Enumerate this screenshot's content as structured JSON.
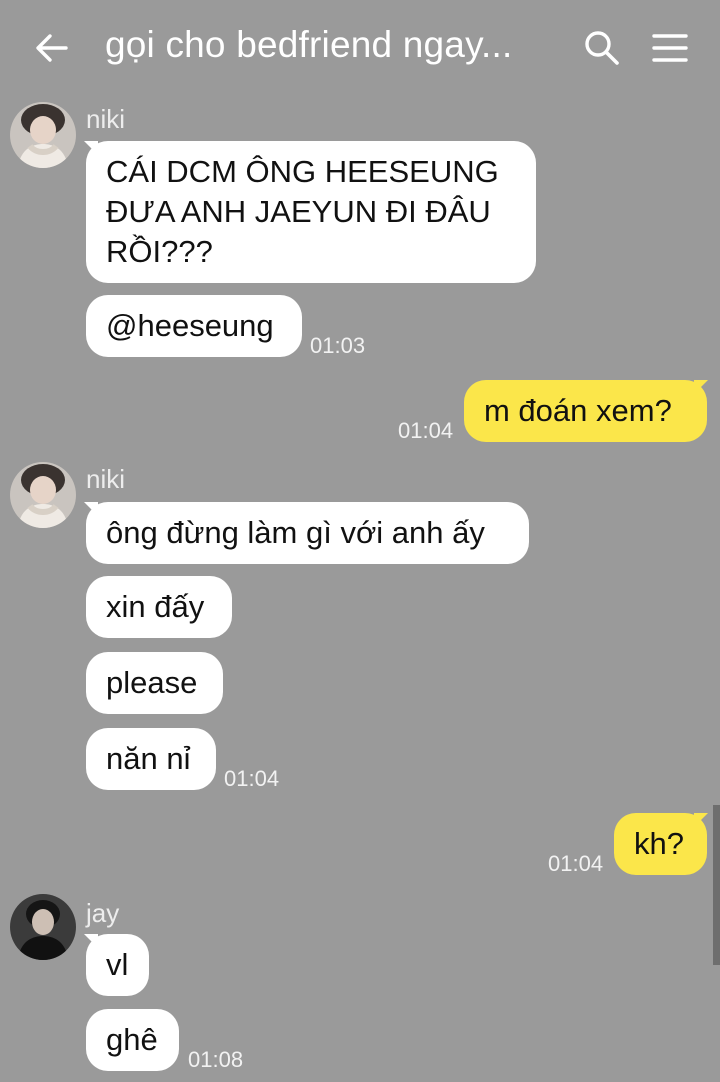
{
  "header": {
    "title": "gọi cho bedfriend ngay...",
    "back_icon": "arrow-left-icon",
    "search_icon": "search-icon",
    "menu_icon": "hamburger-menu-icon"
  },
  "colors": {
    "background": "#9a9a9a",
    "incoming_bubble": "#ffffff",
    "outgoing_bubble": "#fbe64a",
    "text": "#111111"
  },
  "messages": {
    "g1": {
      "sender": "niki",
      "m1": "CÁI DCM ÔNG HEESEUNG ĐƯA ANH JAEYUN ĐI ĐÂU RỒI???",
      "m2": "@heeseung",
      "time": "01:03"
    },
    "o1": {
      "text": "m đoán xem?",
      "time": "01:04"
    },
    "g2": {
      "sender": "niki",
      "m1": "ông đừng làm gì với anh ấy",
      "m2": "xin đấy",
      "m3": "please",
      "m4": "năn nỉ",
      "time": "01:04"
    },
    "o2": {
      "text": "kh?",
      "time": "01:04"
    },
    "g3": {
      "sender": "jay",
      "m1": "vl",
      "m2": "ghê",
      "time": "01:08"
    }
  }
}
